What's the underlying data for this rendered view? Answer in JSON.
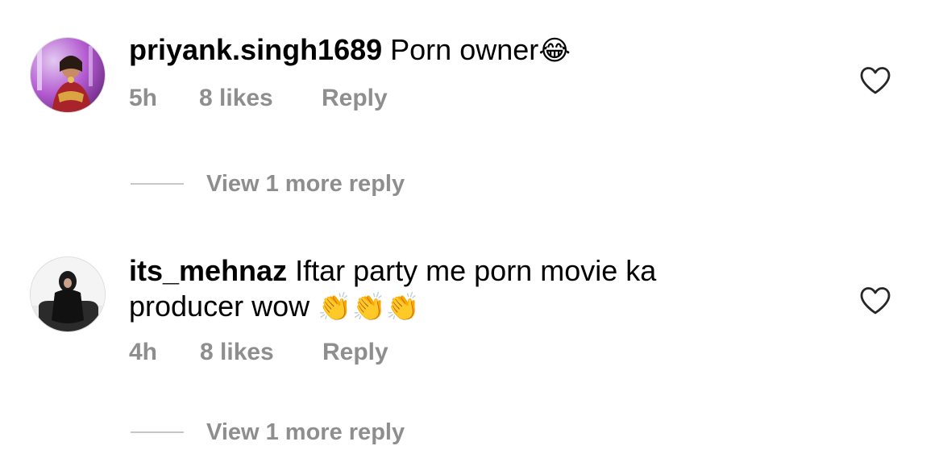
{
  "comments": [
    {
      "username": "priyank.singh1689",
      "text": " Porn owner",
      "emoji": "😂",
      "emoji_icon": "face-with-tears-of-joy-emoji",
      "time": "5h",
      "likes": "8 likes",
      "reply": "Reply"
    },
    {
      "username": "its_mehnaz",
      "text": " Iftar party me porn movie ka producer wow ",
      "emoji": "👏👏👏",
      "emoji_icon": "clapping-hands-emoji",
      "time": "4h",
      "likes": "8 likes",
      "reply": "Reply"
    }
  ],
  "view_more": [
    {
      "label": "View 1 more reply"
    },
    {
      "label": "View 1 more reply"
    }
  ],
  "colors": {
    "meta_gray": "#8e8e8e",
    "line_gray": "#c7c7c7",
    "text": "#000000",
    "background": "#ffffff"
  },
  "icons": {
    "like": "heart-outline-icon"
  }
}
